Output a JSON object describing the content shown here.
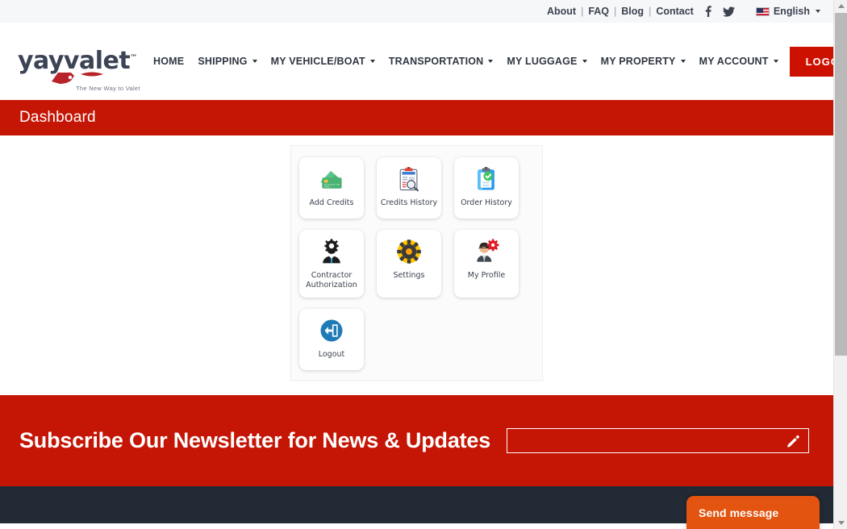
{
  "topbar": {
    "links": [
      "About",
      "FAQ",
      "Blog",
      "Contact"
    ],
    "separator": "|",
    "facebook_icon": "f",
    "twitter_icon": "🐦",
    "language": "English"
  },
  "header": {
    "logo_text": "yayvalet",
    "logo_tm": "™",
    "logo_tagline": "The New Way to Valet",
    "nav": [
      {
        "label": "HOME",
        "has_caret": false
      },
      {
        "label": "SHIPPING",
        "has_caret": true
      },
      {
        "label": "MY VEHICLE/BOAT",
        "has_caret": true
      },
      {
        "label": "TRANSPORTATION",
        "has_caret": true
      },
      {
        "label": "MY LUGGAGE",
        "has_caret": true
      },
      {
        "label": "MY PROPERTY",
        "has_caret": true
      },
      {
        "label": "MY ACCOUNT",
        "has_caret": true
      }
    ],
    "logout_label": "LOGOUT"
  },
  "page": {
    "title": "Dashboard"
  },
  "dashboard": {
    "tiles": [
      {
        "label": "Add Credits",
        "icon": "credit-cards-icon"
      },
      {
        "label": "Credits History",
        "icon": "clipboard-search-icon"
      },
      {
        "label": "Order History",
        "icon": "clipboard-check-icon"
      },
      {
        "label": "Contractor Authorization",
        "icon": "person-gear-dark-icon"
      },
      {
        "label": "Settings",
        "icon": "gear-yellow-icon"
      },
      {
        "label": "My Profile",
        "icon": "person-gear-red-icon"
      },
      {
        "label": "Logout",
        "icon": "logout-arrow-icon"
      }
    ]
  },
  "newsletter": {
    "heading": "Subscribe Our Newsletter for News & Updates",
    "input_value": "",
    "input_placeholder": "",
    "edit_icon": "pencil-icon"
  },
  "chat": {
    "label": "Send message"
  },
  "colors": {
    "brand_red": "#c41505",
    "logout_red": "#cc1100",
    "footer_dark": "#222a35",
    "chat_orange": "#e2540f",
    "topbar_bg": "#f6f7f9"
  }
}
